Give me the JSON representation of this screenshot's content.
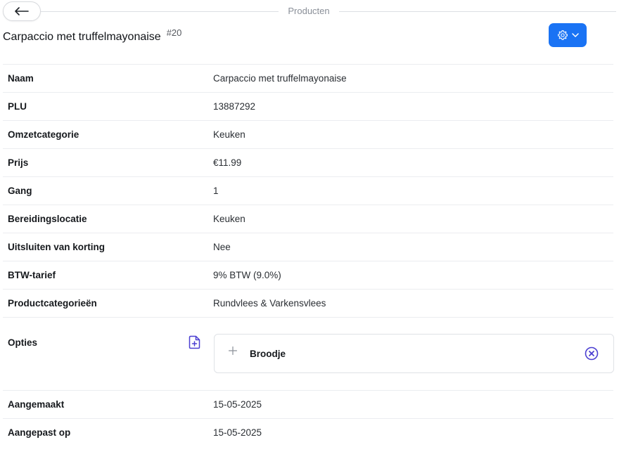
{
  "header": {
    "section_title": "Producten",
    "back_icon": "arrow-left-icon"
  },
  "product": {
    "title": "Carpaccio met truffelmayonaise",
    "id_label": "#20"
  },
  "toolbar": {
    "settings_icon": "gear-icon",
    "dropdown_icon": "chevron-down-icon",
    "accent_color": "#1a73f4"
  },
  "details": [
    {
      "label": "Naam",
      "value": "Carpaccio met truffelmayonaise"
    },
    {
      "label": "PLU",
      "value": "13887292"
    },
    {
      "label": "Omzetcategorie",
      "value": "Keuken"
    },
    {
      "label": "Prijs",
      "value": "€11.99"
    },
    {
      "label": "Gang",
      "value": "1"
    },
    {
      "label": "Bereidingslocatie",
      "value": "Keuken"
    },
    {
      "label": "Uitsluiten van korting",
      "value": "Nee"
    },
    {
      "label": "BTW-tarief",
      "value": "9% BTW (9.0%)"
    },
    {
      "label": "Productcategorieën",
      "value": "Rundvlees & Varkensvlees"
    }
  ],
  "options": {
    "label": "Opties",
    "add_icon": "add-document-icon",
    "items": [
      {
        "label": "Broodje",
        "expand_icon": "plus-icon",
        "remove_icon": "remove-circle-icon"
      }
    ],
    "icon_color": "#4b3fd1"
  },
  "meta": [
    {
      "label": "Aangemaakt",
      "value": "15-05-2025"
    },
    {
      "label": "Aangepast op",
      "value": "15-05-2025"
    }
  ]
}
